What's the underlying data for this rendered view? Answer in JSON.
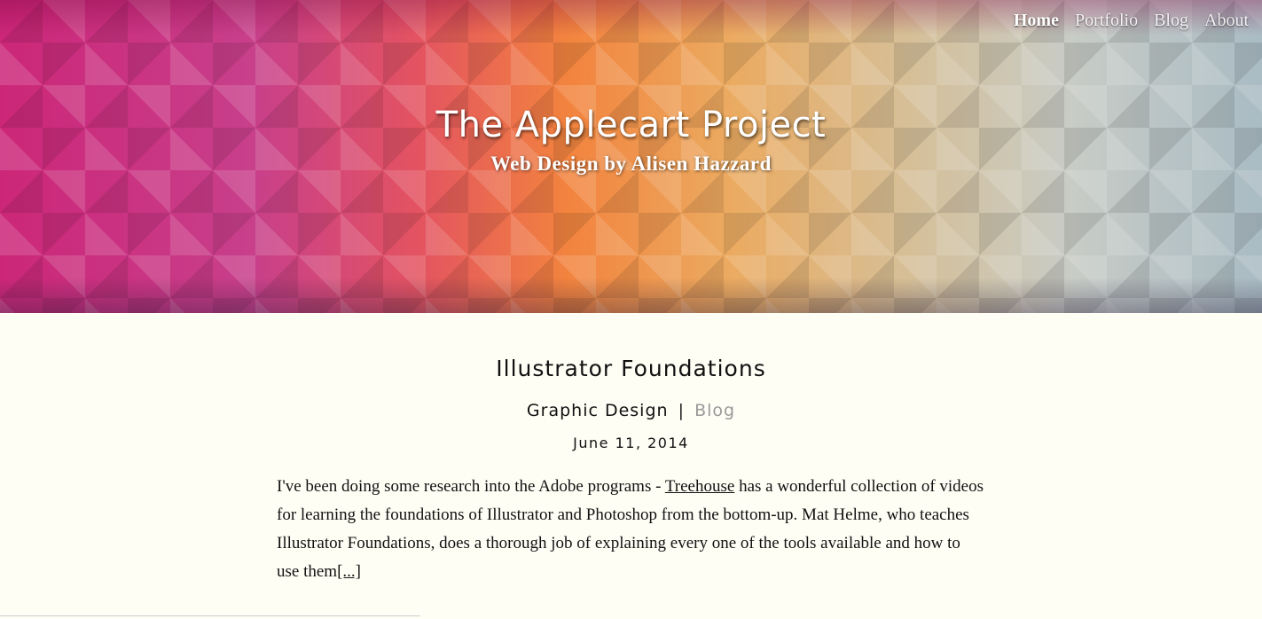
{
  "site": {
    "title": "The Applecart Project",
    "subtitle": "Web Design by Alisen Hazzard"
  },
  "nav": {
    "items": [
      {
        "label": "Home",
        "active": true
      },
      {
        "label": "Portfolio",
        "active": false
      },
      {
        "label": "Blog",
        "active": false
      },
      {
        "label": "About",
        "active": false
      }
    ]
  },
  "post": {
    "title": "Illustrator Foundations",
    "category_primary": "Graphic Design",
    "category_separator": "|",
    "category_secondary": "Blog",
    "date": "June 11, 2014",
    "excerpt_before_link": "I've been doing some research into the Adobe programs - ",
    "link_text": "Treehouse",
    "excerpt_after_link": " has a wonderful collection of videos for learning the foundations of Illustrator and Photoshop from the bottom-up. Mat Helme, who teaches Illustrator Foundations, does a thorough job of explaining every one of the tools available and how to use them",
    "read_more": "[...]"
  },
  "colors": {
    "page_background": "#fffef5",
    "muted_link": "#999999",
    "text": "#111111"
  }
}
